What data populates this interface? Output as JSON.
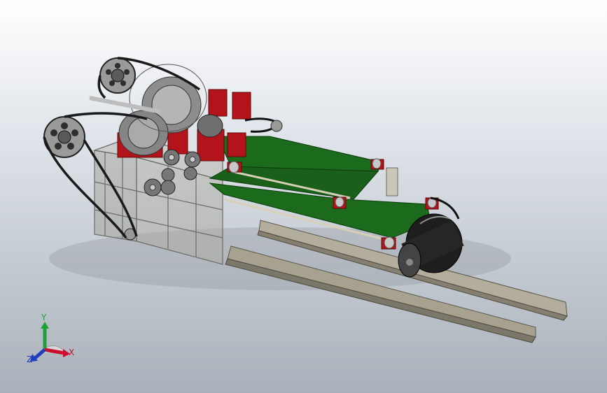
{
  "view": {
    "background_top": "#ffffff",
    "background_bottom": "#a9b0b9"
  },
  "triad": {
    "x_label": "X",
    "y_label": "Y",
    "z_label": "Z",
    "x_color": "#c8102e",
    "y_color": "#1f9e3a",
    "z_color": "#1f3fbf"
  },
  "model": {
    "frame_color": "#8c8c86",
    "belt_color": "#1c6b1c",
    "bracket_color": "#b3131b",
    "rail_color": "#a7a290",
    "drum_color": "#1e1e1e",
    "pulley_color": "#9a9a9a"
  }
}
